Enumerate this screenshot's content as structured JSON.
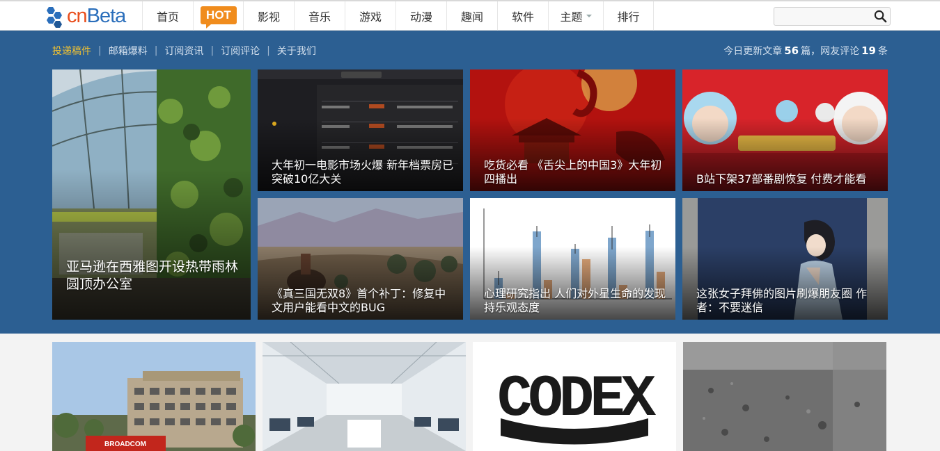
{
  "brand": {
    "logo_text_c": "cn",
    "logo_text_rest": "Beta"
  },
  "nav": {
    "items": [
      {
        "label": "首页",
        "key": "home"
      },
      {
        "label": "HOT",
        "key": "hot"
      },
      {
        "label": "影视",
        "key": "movies"
      },
      {
        "label": "音乐",
        "key": "music"
      },
      {
        "label": "游戏",
        "key": "games"
      },
      {
        "label": "动漫",
        "key": "anime"
      },
      {
        "label": "趣闻",
        "key": "funny"
      },
      {
        "label": "软件",
        "key": "software"
      },
      {
        "label": "主题",
        "key": "topics",
        "has_dropdown": true
      },
      {
        "label": "排行",
        "key": "ranking"
      }
    ],
    "search_placeholder": ""
  },
  "subnav": {
    "links": [
      "投递稿件",
      "邮箱爆料",
      "订阅资讯",
      "订阅评论",
      "关于我们"
    ]
  },
  "stats": {
    "prefix": "今日更新文章",
    "articles": "56",
    "mid": "篇，网友评论",
    "comments": "19",
    "suffix": "条"
  },
  "featured": [
    {
      "title": "亚马逊在西雅图开设热带雨林圆顶办公室",
      "image": "greenhouse-office"
    },
    {
      "title": "大年初一电影市场火爆 新年档票房已突破10亿大关",
      "image": "box-office-screen"
    },
    {
      "title": "吃货必看 《舌尖上的中国3》大年初四播出",
      "image": "chi-fan-poster"
    },
    {
      "title": "B站下架37部番剧恢复 付费才能看",
      "image": "bilibili-2018"
    },
    {
      "title": "《真三国无双8》首个补丁：修复中文用户能看中文的BUG",
      "image": "dynasty-warriors"
    },
    {
      "title": "心理研究指出 人们对外星生命的发现持乐观态度",
      "image": "bar-chart-study"
    },
    {
      "title": "这张女子拜佛的图片刷爆朋友圈 作者：不要迷信",
      "image": "praying-girl"
    }
  ],
  "thumbs": [
    {
      "image": "broadcom-building",
      "text": "BROADCOM"
    },
    {
      "image": "office-interior",
      "text": ""
    },
    {
      "image": "codex-logo",
      "text": "CODEX"
    },
    {
      "image": "mars-surface",
      "text": ""
    }
  ],
  "colors": {
    "band": "#2c5f92",
    "hot": "#f08c1d",
    "logo_blue": "#2a6ebb",
    "logo_orange": "#e94f1d",
    "highlight": "#f1c232"
  }
}
